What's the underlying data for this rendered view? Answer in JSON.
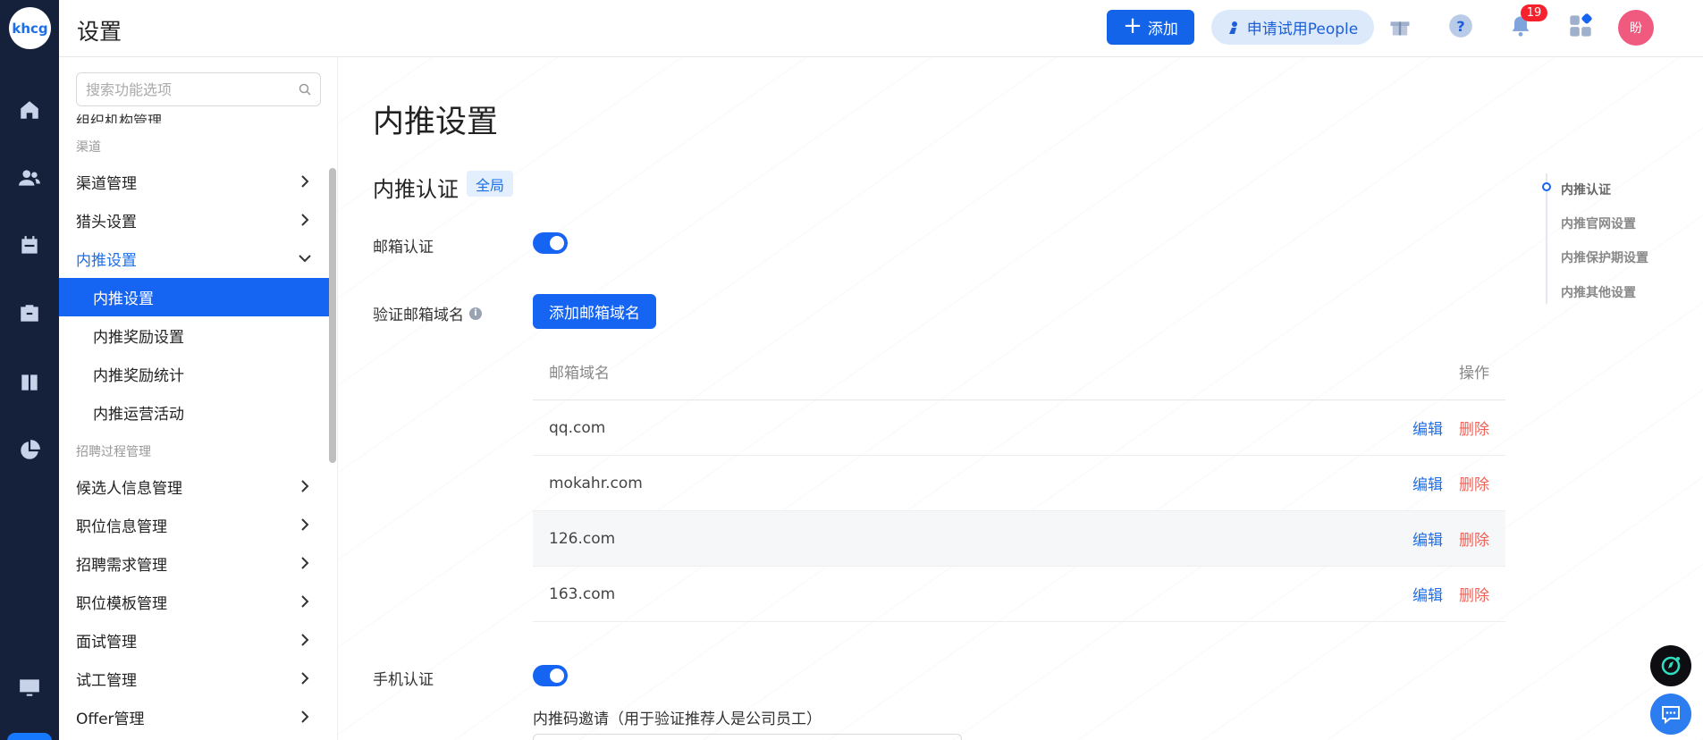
{
  "app": {
    "logo_text": "khcg",
    "page_header": "设置"
  },
  "header": {
    "add_label": "添加",
    "trial_label": "申请试用People",
    "notification_count": "19",
    "avatar_text": "盼"
  },
  "sidebar": {
    "search_placeholder": "搜索功能选项",
    "cut_item": "组织机构管理",
    "groups": [
      {
        "title": "渠道"
      },
      {
        "title": "招聘过程管理"
      }
    ],
    "items": [
      {
        "label": "渠道管理"
      },
      {
        "label": "猎头设置"
      },
      {
        "label": "内推设置"
      },
      {
        "label": "候选人信息管理"
      },
      {
        "label": "职位信息管理"
      },
      {
        "label": "招聘需求管理"
      },
      {
        "label": "职位模板管理"
      },
      {
        "label": "面试管理"
      },
      {
        "label": "试工管理"
      },
      {
        "label": "Offer管理"
      }
    ],
    "sub_items": [
      {
        "label": "内推设置"
      },
      {
        "label": "内推奖励设置"
      },
      {
        "label": "内推奖励统计"
      },
      {
        "label": "内推运营活动"
      }
    ]
  },
  "main": {
    "title": "内推设置",
    "section_title": "内推认证",
    "scope_tag": "全局",
    "email_auth_label": "邮箱认证",
    "email_auth_on": true,
    "domain_label": "验证邮箱域名",
    "add_domain_button": "添加邮箱域名",
    "table": {
      "col_domain": "邮箱域名",
      "col_ops": "操作",
      "edit_label": "编辑",
      "delete_label": "删除",
      "rows": [
        {
          "domain": "qq.com"
        },
        {
          "domain": "mokahr.com"
        },
        {
          "domain": "126.com"
        },
        {
          "domain": "163.com"
        }
      ]
    },
    "phone_auth_label": "手机认证",
    "phone_auth_on": true,
    "invite_code_note": "内推码邀请（用于验证推荐人是公司员工）"
  },
  "anchor_nav": [
    {
      "label": "内推认证"
    },
    {
      "label": "内推官网设置"
    },
    {
      "label": "内推保护期设置"
    },
    {
      "label": "内推其他设置"
    }
  ],
  "colors": {
    "primary": "#1664f2",
    "rail": "#15213b",
    "danger": "#f0635a",
    "avatar": "#f05a7e"
  }
}
